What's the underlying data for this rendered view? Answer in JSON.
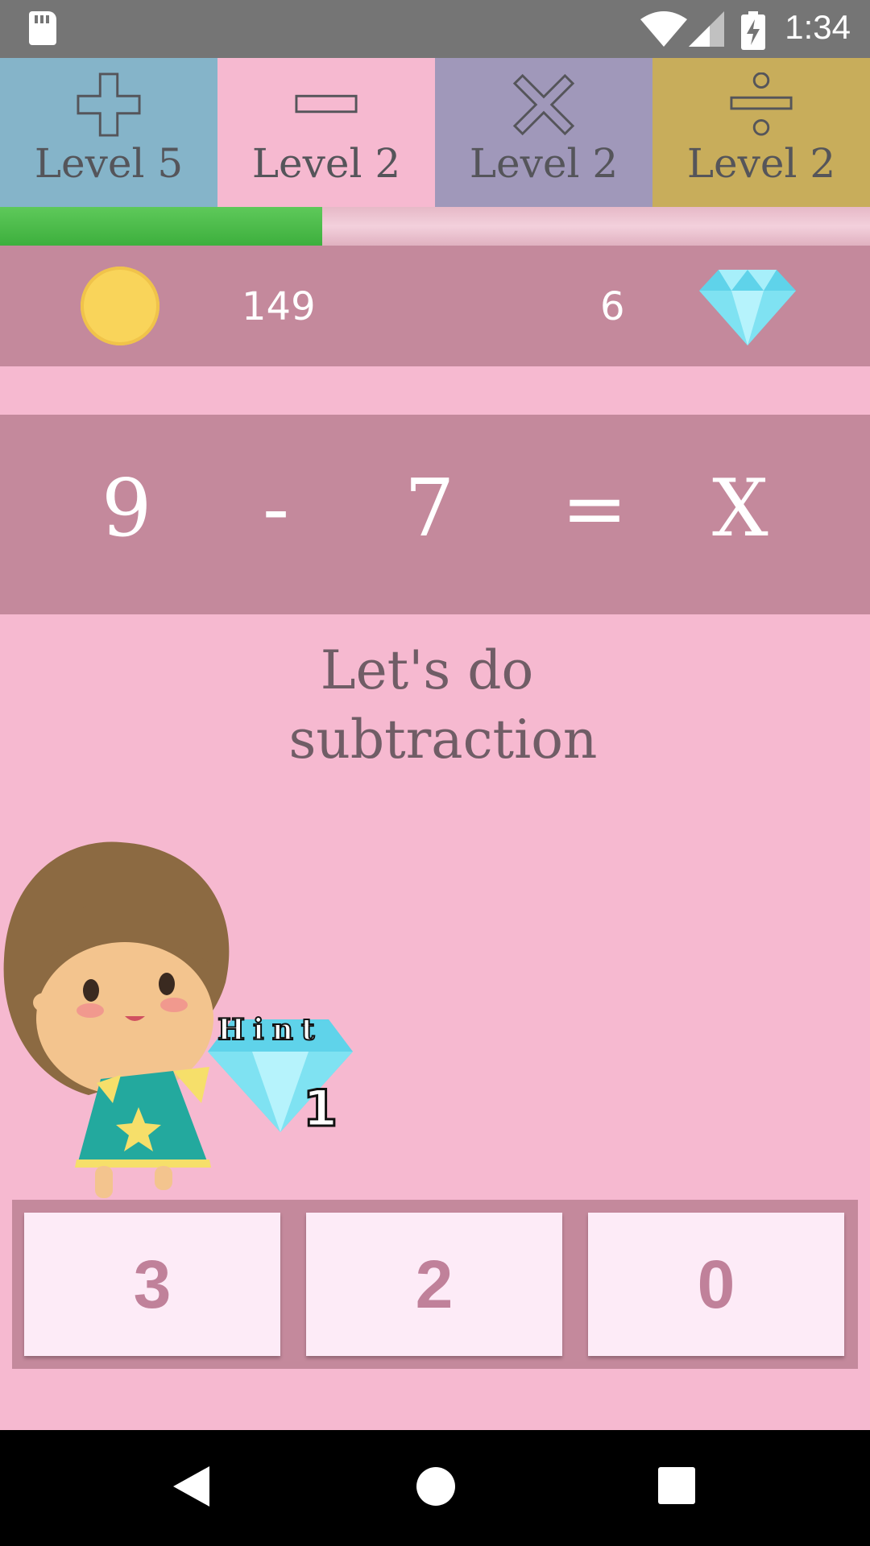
{
  "status_bar": {
    "time": "1:34"
  },
  "tabs": [
    {
      "label": "Level 5",
      "icon": "plus-icon",
      "color": "#85b4c9"
    },
    {
      "label": "Level 2",
      "icon": "minus-icon",
      "color": "#f6b9d0"
    },
    {
      "label": "Level 2",
      "icon": "times-icon",
      "color": "#a098ba"
    },
    {
      "label": "Level 2",
      "icon": "divide-icon",
      "color": "#c8ad5b"
    }
  ],
  "progress": {
    "value": 0.37,
    "color": "#45b845"
  },
  "scores": {
    "coins": "149",
    "gems": "6"
  },
  "equation": {
    "left": "9",
    "operator": "-",
    "right": "7",
    "equals": "=",
    "result": "X"
  },
  "instruction": {
    "line1": "Let's do",
    "line2": "subtraction"
  },
  "hint": {
    "label": "Hint",
    "count": "1"
  },
  "answers": [
    "3",
    "2",
    "0"
  ],
  "colors": {
    "background": "#f6b9d0",
    "panel": "#c4899c",
    "answer_bg": "#fdebf7",
    "answer_text": "#c0819a"
  }
}
